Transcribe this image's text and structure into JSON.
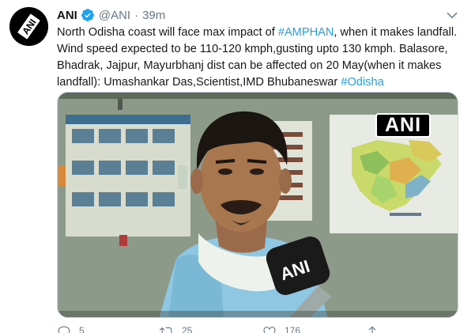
{
  "tweet": {
    "author_name": "ANI",
    "handle": "@ANI",
    "separator": "·",
    "time": "39m",
    "text_parts": [
      {
        "t": "North Odisha coast will face max impact of ",
        "link": false
      },
      {
        "t": "#AMPHAN",
        "link": true
      },
      {
        "t": ", when it makes landfall. Wind speed expected to be 110-120 kmph,gusting upto 130 kmph. Balasore, Bhadrak, Jajpur, Mayurbhanj dist can be affected on 20 May(when it makes landfall): Umashankar Das,Scientist,IMD Bhubaneswar ",
        "link": false
      },
      {
        "t": "#Odisha",
        "link": true
      }
    ],
    "media_badge": "ANI",
    "mic_logo": "ANI"
  },
  "actions": [
    {
      "name": "reply",
      "icon": "reply-icon",
      "count": "5"
    },
    {
      "name": "retweet",
      "icon": "retweet-icon",
      "count": "25"
    },
    {
      "name": "like",
      "icon": "heart-icon",
      "count": "176"
    },
    {
      "name": "share",
      "icon": "share-icon",
      "count": ""
    }
  ],
  "colors": {
    "link": "#1da1f2",
    "verified": "#1da1f2",
    "muted": "#657786"
  }
}
